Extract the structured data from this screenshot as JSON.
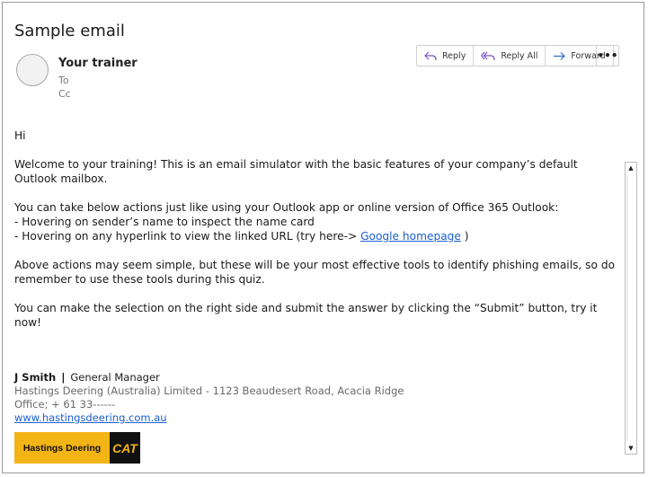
{
  "email": {
    "subject": "Sample email",
    "sender": "Your trainer",
    "to_label": "To",
    "cc_label": "Cc"
  },
  "actions": {
    "reply": "Reply",
    "reply_all": "Reply All",
    "forward": "Forward",
    "more": "•••"
  },
  "body": {
    "greeting": "Hi",
    "p1": "Welcome to your training! This is an email simulator with the basic features of your company’s default Outlook mailbox.",
    "p2_line1": "You can take below actions just like using your Outlook app or online version of Office 365 Outlook:",
    "p2_line2": "- Hovering on sender’s name to inspect the name card",
    "p2_line3_prefix": "- Hovering on any hyperlink to view the linked URL (try here-> ",
    "p2_link": "Google homepage",
    "p2_line3_suffix": " )",
    "p3": "Above actions may seem simple, but these will be your most effective tools to identify phishing emails, so do remember to use these tools during this quiz.",
    "p4": "You can make the selection on the right side and submit the answer by clicking the “Submit” button, try it now!"
  },
  "signature": {
    "name": "J Smith",
    "separator": "|",
    "title": "General Manager",
    "company_line": "Hastings Deering (Australia) Limited -  1123 Beaudesert Road, Acacia Ridge",
    "office_line": "Office; + 61 33------",
    "website": "www.hastingsdeering.com.au",
    "logo_text": "Hastings Deering",
    "logo_badge": "CAT"
  },
  "colors": {
    "link": "#1a5fd1",
    "reply_icon": "#7a52c7",
    "forward_icon": "#2a6fd6",
    "logo_yellow": "#f3b515"
  },
  "scrollbar": {
    "up": "▲",
    "down": "▼"
  }
}
